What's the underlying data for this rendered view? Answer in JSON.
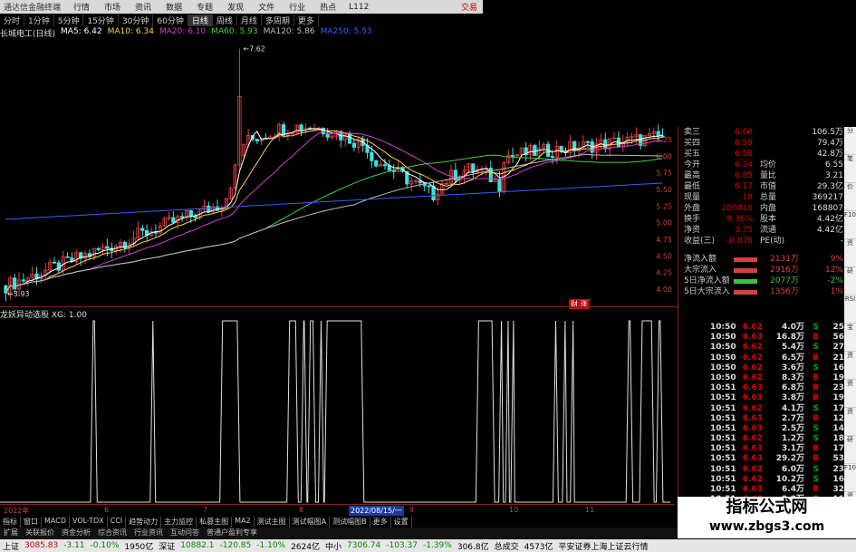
{
  "window": {
    "app_title": "通达信金融终端",
    "menus": [
      "行情",
      "市场",
      "资讯",
      "数据",
      "专题",
      "发现",
      "文件",
      "行业",
      "热点"
    ],
    "code": "L112",
    "right_label": "交易"
  },
  "periods": [
    {
      "label": "分时",
      "active": false
    },
    {
      "label": "1分钟",
      "active": false
    },
    {
      "label": "5分钟",
      "active": false
    },
    {
      "label": "15分钟",
      "active": false
    },
    {
      "label": "30分钟",
      "active": false
    },
    {
      "label": "60分钟",
      "active": false
    },
    {
      "label": "日线",
      "active": true
    },
    {
      "label": "周线",
      "active": false
    },
    {
      "label": "月线",
      "active": false
    },
    {
      "label": "多周期",
      "active": false
    },
    {
      "label": "更多",
      "active": false
    }
  ],
  "ma_legend": {
    "stock": "长城电工(日线)",
    "ma5": "MA5: 6.42",
    "ma10": "MA10: 6.34",
    "ma20": "MA20: 6.10",
    "ma60": "MA60: 5.93",
    "ma120": "MA120: 5.86",
    "ma250": "MA250: 5.53",
    "colors": {
      "ma5": "#ffffff",
      "ma10": "#ffd24a",
      "ma20": "#d040d0",
      "ma60": "#40d040",
      "ma120": "#bbbbbb",
      "ma250": "#3a5cff"
    }
  },
  "price_axis": [
    "6.25",
    "6.00",
    "5.75",
    "5.50",
    "5.25",
    "5.00",
    "4.75",
    "4.50",
    "4.25",
    "4.00"
  ],
  "annotations": {
    "high": "7.62",
    "low": "3.93"
  },
  "indicator": {
    "title": "龙妖异动选股 XG: 1.00",
    "axis": [
      "1.00",
      "0.89",
      "0.80",
      "0.60",
      "0.40",
      "0.20",
      "0.00"
    ],
    "current_value": "0.89",
    "signal_periods": [
      [
        0.135,
        0.145
      ],
      [
        0.224,
        0.232
      ],
      [
        0.328,
        0.358
      ],
      [
        0.428,
        0.445
      ],
      [
        0.449,
        0.458
      ],
      [
        0.459,
        0.471
      ],
      [
        0.475,
        0.483
      ],
      [
        0.484,
        0.543
      ],
      [
        0.71,
        0.738
      ],
      [
        0.744,
        0.751
      ],
      [
        0.754,
        0.76
      ],
      [
        0.762,
        0.768
      ],
      [
        0.825,
        0.833
      ],
      [
        0.839,
        0.846
      ],
      [
        0.851,
        0.857
      ],
      [
        0.934,
        0.944
      ],
      [
        0.954,
        0.976
      ],
      [
        0.979,
        0.989
      ]
    ]
  },
  "date_axis": {
    "labels": [
      "2022年",
      "6",
      "7",
      "8",
      "9",
      "2022/08/15/一",
      "10",
      "11"
    ],
    "positions_hint": "x"
  },
  "tabs": [
    "指标",
    "窗口",
    "MACD",
    "VOL-TDX",
    "CCI",
    "趋势动力",
    "主力监控",
    "私募主图",
    "MA2",
    "测试主图",
    "测试幅图A",
    "测试幅图B",
    "更多",
    "设置"
  ],
  "links": [
    "扩展",
    "关联报价",
    "资金分析",
    "综合资讯",
    "行业资讯",
    "互动问答",
    "普通户盈利专享"
  ],
  "quote": {
    "rows": [
      {
        "l": "卖三",
        "v": "6.60",
        "l2": "",
        "v2": "106.5万"
      },
      {
        "l": "买四",
        "v": "6.59",
        "l2": "",
        "v2": "79.4万"
      },
      {
        "l": "买五",
        "v": "6.58",
        "l2": "",
        "v2": "42.8万"
      },
      {
        "l": "今开",
        "v": "6.34",
        "l2": "均价",
        "v2": "6.55"
      },
      {
        "l": "最高",
        "v": "6.85",
        "l2": "量比",
        "v2": "3.21"
      },
      {
        "l": "最低",
        "v": "6.17",
        "l2": "市值",
        "v2": "29.3亿"
      },
      {
        "l": "现量",
        "v": "18",
        "l2": "总量",
        "v2": "369217"
      },
      {
        "l": "外盘",
        "v": "200410",
        "l2": "内盘",
        "v2": "168807"
      },
      {
        "l": "换手",
        "v": "8.36%",
        "l2": "股本",
        "v2": "4.42亿"
      },
      {
        "l": "净资",
        "v": "3.75",
        "l2": "流通",
        "v2": "4.42亿"
      },
      {
        "l": "收益(三)",
        "v": "-0.070",
        "l2": "PE(动)",
        "v2": "-"
      }
    ]
  },
  "flows": [
    {
      "l": "净流入额",
      "v": "2131万",
      "p": "9%",
      "color": "#d84040"
    },
    {
      "l": "大宗流入",
      "v": "2916万",
      "p": "12%",
      "color": "#d84040"
    },
    {
      "l": "5日净流入额",
      "v": "2077万",
      "p": "-2%",
      "color": "#40c040"
    },
    {
      "l": "5日大宗流入",
      "v": "1356万",
      "p": "1%",
      "color": "#d84040"
    }
  ],
  "ticks": [
    {
      "t": "10:50",
      "pr": "6.62",
      "vol": "4.0万",
      "bs": "S",
      "n": "25"
    },
    {
      "t": "10:50",
      "pr": "6.63",
      "vol": "16.8万",
      "bs": "B",
      "n": "56"
    },
    {
      "t": "10:50",
      "pr": "6.62",
      "vol": "5.4万",
      "bs": "S",
      "n": "27"
    },
    {
      "t": "10:50",
      "pr": "6.62",
      "vol": "6.5万",
      "bs": "B",
      "n": "21"
    },
    {
      "t": "10:50",
      "pr": "6.62",
      "vol": "3.6万",
      "bs": "S",
      "n": "16"
    },
    {
      "t": "10:50",
      "pr": "6.62",
      "vol": "8.3万",
      "bs": "B",
      "n": "19"
    },
    {
      "t": "10:51",
      "pr": "6.63",
      "vol": "6.8万",
      "bs": "B",
      "n": "23"
    },
    {
      "t": "10:51",
      "pr": "6.63",
      "vol": "3.8万",
      "bs": "B",
      "n": "19"
    },
    {
      "t": "10:51",
      "pr": "6.62",
      "vol": "4.1万",
      "bs": "S",
      "n": "17"
    },
    {
      "t": "10:51",
      "pr": "6.63",
      "vol": "2.7万",
      "bs": "B",
      "n": "12"
    },
    {
      "t": "10:51",
      "pr": "6.63",
      "vol": "2.5万",
      "bs": "S",
      "n": "14"
    },
    {
      "t": "10:51",
      "pr": "6.62",
      "vol": "1.2万",
      "bs": "S",
      "n": "18"
    },
    {
      "t": "10:51",
      "pr": "6.63",
      "vol": "3.1万",
      "bs": "B",
      "n": "17"
    },
    {
      "t": "10:51",
      "pr": "6.63",
      "vol": "29.2万",
      "bs": "B",
      "n": "53"
    },
    {
      "t": "10:51",
      "pr": "6.62",
      "vol": "6.0万",
      "bs": "S",
      "n": "23"
    },
    {
      "t": "10:51",
      "pr": "6.62",
      "vol": "10.2万",
      "bs": "S",
      "n": "16"
    },
    {
      "t": "10:51",
      "pr": "6.63",
      "vol": "6.4万",
      "bs": "B",
      "n": "32"
    },
    {
      "t": "10:51",
      "pr": "6.63",
      "vol": "2.2万",
      "bs": "S",
      "n": "11"
    }
  ],
  "right_tabs": [
    "分",
    "笔",
    "价",
    "F10",
    "资",
    "研",
    "RSI",
    "宝",
    "资",
    "资",
    "资",
    "研",
    "F10",
    "资",
    "资"
  ],
  "status": {
    "sh_label": "上证",
    "sh_val": "3085.83",
    "sh_chg": "-3.11",
    "sh_pct": "-0.10%",
    "sh_amt": "1950亿",
    "sz_label": "深证",
    "sz_val": "10882.1",
    "sz_chg": "-120.85",
    "sz_pct": "-1.10%",
    "sz_amt": "2624亿",
    "zx_label": "中小",
    "zx_val": "7306.74",
    "zx_chg": "-103.37",
    "zx_pct": "-1.39%",
    "zx_amt": "306.8亿",
    "total_label": "总成交",
    "total_val": "4573亿",
    "broker": "平安证券上海上证云行情"
  },
  "caixun": "财 涨",
  "watermark": {
    "line1": "指标公式网",
    "line2": "www.zbgs3.com"
  }
}
